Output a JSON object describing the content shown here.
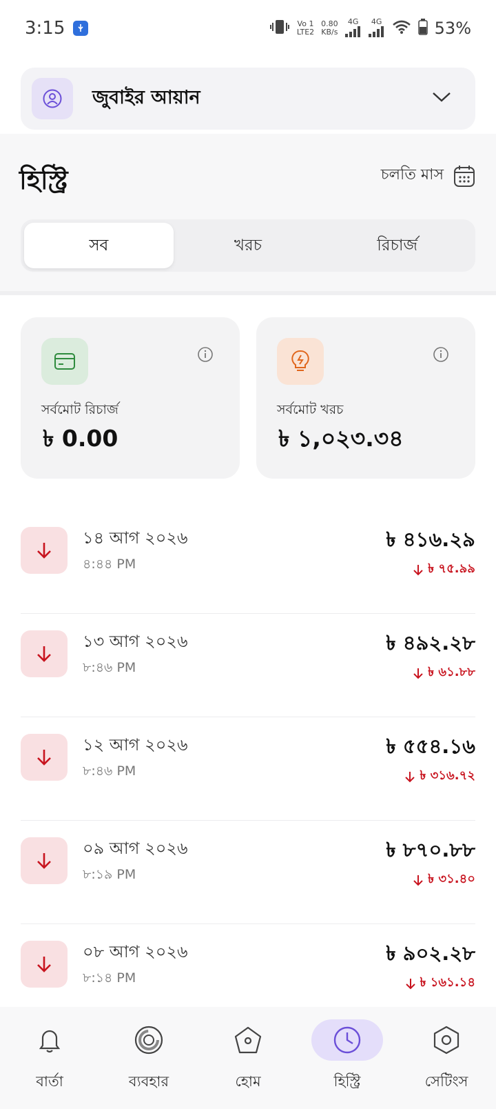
{
  "status_bar": {
    "time": "3:15",
    "net_speed_top": "0.80",
    "net_speed_bottom": "KB/s",
    "volte_top": "Vo 1",
    "volte_bottom": "LTE2",
    "sim1_label": "4G",
    "sim2_label": "4G",
    "battery_percent": "53%"
  },
  "account": {
    "name": "জুবাইর আয়ান"
  },
  "history": {
    "title": "হিস্ট্রি",
    "period_label": "চলতি মাস",
    "tabs": [
      {
        "label": "সব",
        "active": true
      },
      {
        "label": "খরচ",
        "active": false
      },
      {
        "label": "রিচার্জ",
        "active": false
      }
    ]
  },
  "summary": {
    "recharge": {
      "label": "সর্বমোট রিচার্জ",
      "amount": "৳ 0.00",
      "color": "#2e8b3d"
    },
    "expense": {
      "label": "সর্বমোট খরচ",
      "amount": "৳ ১,০২৩.৩৪",
      "color": "#e0661c"
    }
  },
  "transactions": [
    {
      "date": "১৪ আগ ২০২৬",
      "time": "৪:৪৪ PM",
      "amount": "৳ ৪১৬.২৯",
      "delta": "৳ ৭৫.৯৯"
    },
    {
      "date": "১৩ আগ ২০২৬",
      "time": "৮:৪৬ PM",
      "amount": "৳ ৪৯২.২৮",
      "delta": "৳ ৬১.৮৮"
    },
    {
      "date": "১২ আগ ২০২৬",
      "time": "৮:৪৬ PM",
      "amount": "৳ ৫৫৪.১৬",
      "delta": "৳ ৩১৬.৭২"
    },
    {
      "date": "০৯ আগ ২০২৬",
      "time": "৮:১৯ PM",
      "amount": "৳ ৮৭০.৮৮",
      "delta": "৳ ৩১.৪০"
    },
    {
      "date": "০৮ আগ ২০২৬",
      "time": "৮:১৪ PM",
      "amount": "৳ ৯০২.২৮",
      "delta": "৳ ১৬১.১৪"
    }
  ],
  "nav": [
    {
      "label": "বার্তা",
      "icon": "bell-icon",
      "active": false
    },
    {
      "label": "ব্যবহার",
      "icon": "usage-ring-icon",
      "active": false
    },
    {
      "label": "হোম",
      "icon": "home-icon",
      "active": false
    },
    {
      "label": "হিস্ট্রি",
      "icon": "clock-icon",
      "active": true
    },
    {
      "label": "সেটিংস",
      "icon": "settings-icon",
      "active": false
    }
  ],
  "colors": {
    "accent": "#6b4fd8",
    "debit": "#c8141f",
    "debit_bg": "#f9e0e2"
  }
}
